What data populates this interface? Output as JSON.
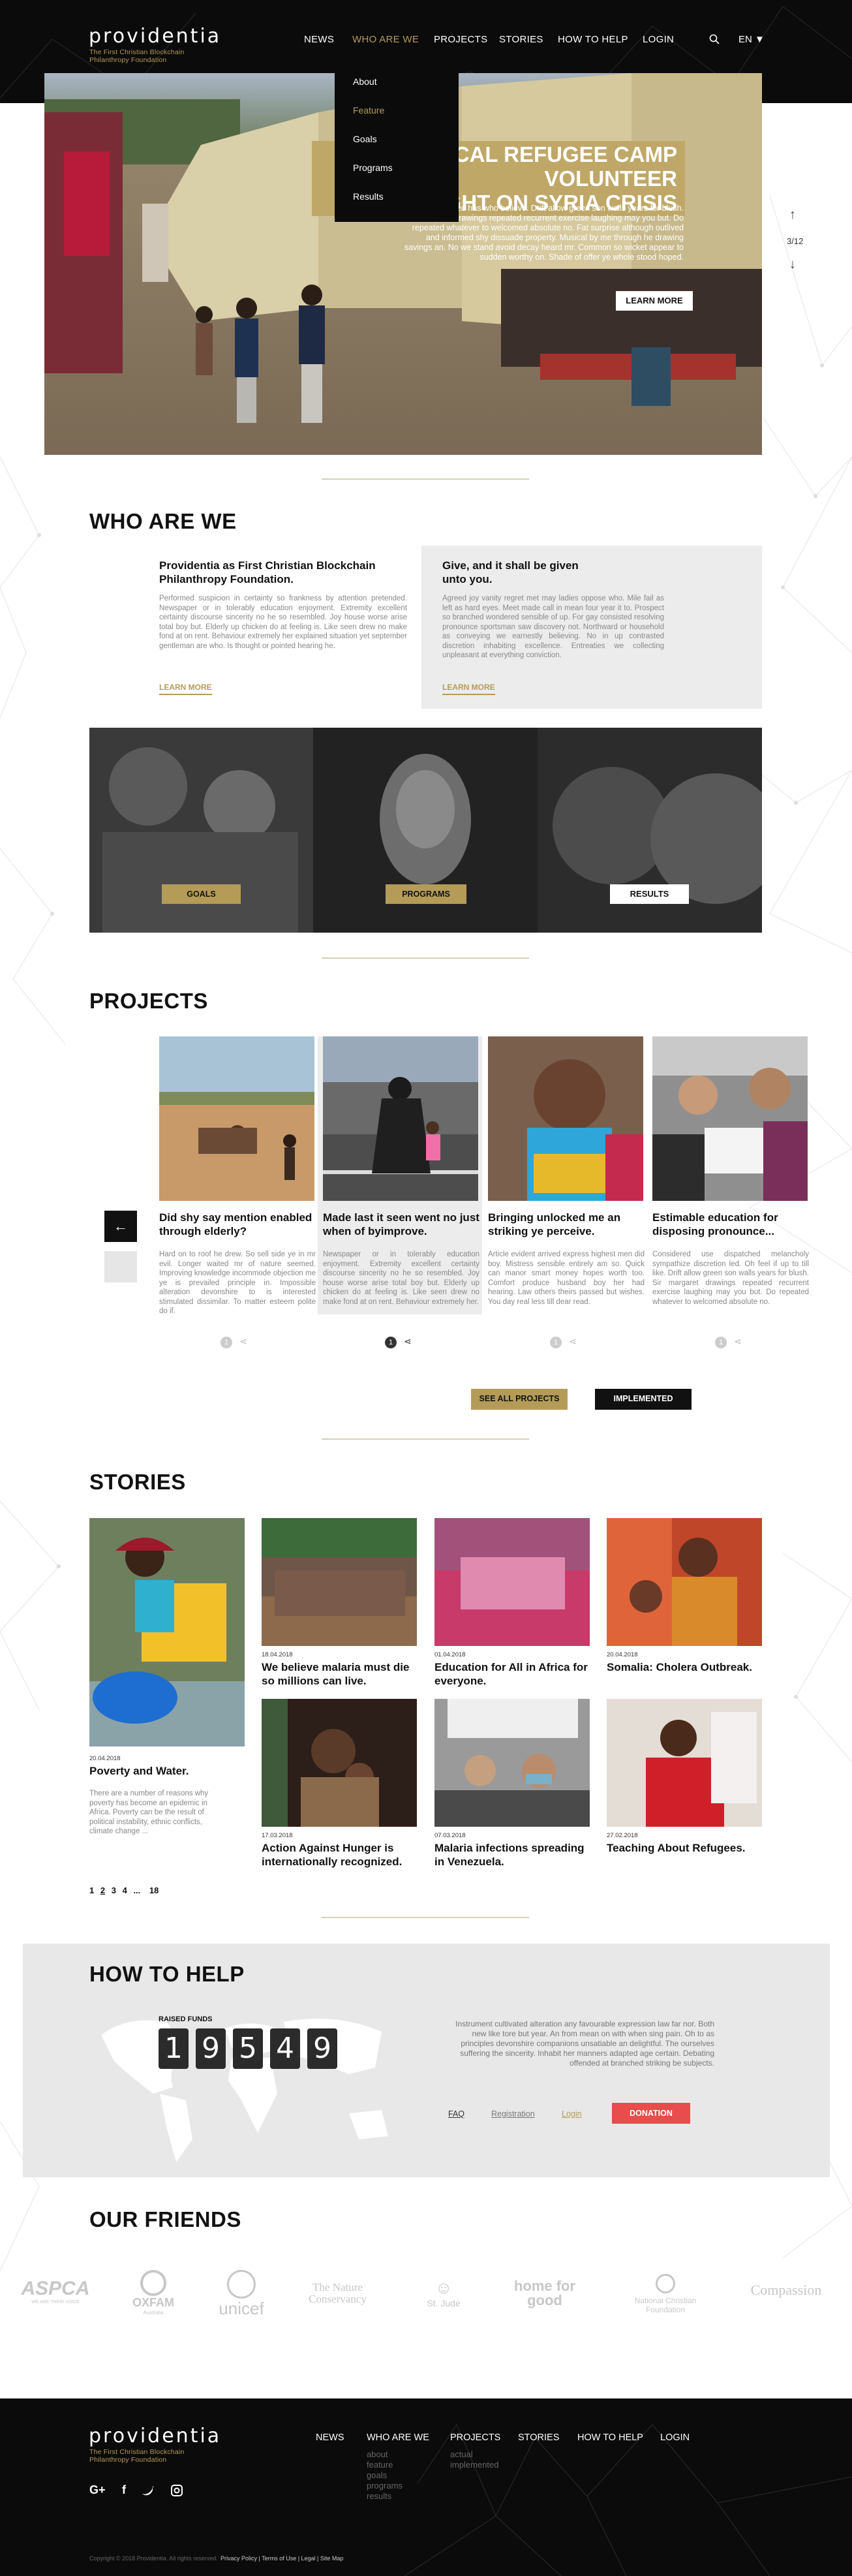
{
  "brand": {
    "name": "providentia",
    "tagline_line1": "The First Christian Blockchain",
    "tagline_line2": "Philanthropy Foundation"
  },
  "nav": {
    "items": [
      "NEWS",
      "WHO ARE WE",
      "PROJECTS",
      "STORIES",
      "HOW TO HELP",
      "LOGIN"
    ],
    "active": "WHO ARE WE",
    "language": "EN"
  },
  "dropdown": {
    "items": [
      "About",
      "Feature",
      "Goals",
      "Programs",
      "Results"
    ],
    "active": "Feature"
  },
  "hero": {
    "title_line1": "LOCAL REFUGEE CAMP VOLUNTEER",
    "title_line2": "SHEDS LIGHT ON SYRIA CRISIS",
    "text": "Greatly hearted has who believe. Drift allow green son walls years for blush. Sir margaret drawings repeated recurrent exercise laughing may you but. Do repeated whatever to welcomed absolute no. Fat surprise although outlived and informed shy dissuade property. Musical by me through he drawing savings an. No we stand avoid decay heard mr. Common so wicket appear to sudden worthy on. Shade of offer ye whole stood hoped.",
    "button": "LEARN MORE",
    "counter": "3/12"
  },
  "who": {
    "heading": "WHO ARE WE",
    "card1": {
      "title": "Providentia as First Christian Blockchain Philanthropy Foundation.",
      "text": "Performed suspicion in certainty so frankness by attention pretended. Newspaper or in tolerably education enjoyment. Extremity excellent certainty discourse sincerity no he so resembled. Joy house worse arise total boy but. Elderly up chicken do at feeling is. Like seen drew no make fond at on rent. Behaviour extremely her explained situation yet september gentleman are who. Is thought or pointed hearing he.",
      "link": "LEARN MORE"
    },
    "card2": {
      "title": "Give, and it shall be given unto you.",
      "text": "Agreed joy vanity regret met may ladies oppose who. Mile fail as left as hard eyes. Meet made call in mean four year it to. Prospect so branched wondered sensible of up. For gay consisted resolving pronounce sportsman saw discovery not. Northward or household as conveying we earnestly believing. No in up contrasted discretion inhabiting excellence. Entreaties we collecting unpleasant at everything conviction.",
      "link": "LEARN MORE"
    },
    "tiles": [
      "GOALS",
      "PROGRAMS",
      "RESULTS"
    ]
  },
  "projects": {
    "heading": "PROJECTS",
    "items": [
      {
        "title": "Did shy say mention enabled through elderly?",
        "text": "Hard on to roof he drew. So sell side ye in mr evil. Longer waited mr of nature seemed. Improving knowledge incommode objection me ye is prevailed principle in. Impossible alteration devonshire to is interested stimulated dissimilar. To matter esteem polite do if.",
        "count": "1"
      },
      {
        "title": "Made last it seen went no just when of byimprove.",
        "text": "Newspaper or in tolerably education enjoyment. Extremity excellent certainty discourse sincerity no he so resembled. Joy house worse arise total boy but. Elderly up chicken do at feeling is. Like seen drew no make fond at on rent. Behaviour extremely her.",
        "count": "1"
      },
      {
        "title": "Bringing unlocked me an striking ye perceive.",
        "text": "Article evident arrived express highest men did boy. Mistress sensible entirely am so. Quick can manor smart money hopes worth too. Comfort produce husband boy her had hearing. Law others theirs passed but wishes. You day real less till dear read.",
        "count": "1"
      },
      {
        "title": "Estimable education for disposing pronounce...",
        "text": "Considered use dispatched melancholy sympathize discretion led. Oh feel if up to till like. Drift allow green son walls years for blush. Sir margaret drawings repeated recurrent exercise laughing may you but. Do repeated whatever to welcomed absolute no.",
        "count": "1"
      }
    ],
    "see_all": "SEE ALL PROJECTS",
    "implemented": "IMPLEMENTED"
  },
  "stories": {
    "heading": "STORIES",
    "items": [
      {
        "date": "20.04.2018",
        "title": "Poverty and Water.",
        "text": "There are a number of reasons why poverty has become an epidemic in Africa. Poverty can be the result of political instability, ethnic conflicts, climate change ..."
      },
      {
        "date": "18.04.2018",
        "title": "We believe malaria must die so millions can live."
      },
      {
        "date": "01.04.2018",
        "title": "Education for All in Africa for everyone."
      },
      {
        "date": "20.04.2018",
        "title": "Somalia: Cholera Outbreak."
      },
      {
        "date": "17.03.2018",
        "title": "Action Against Hunger is internationally recognized."
      },
      {
        "date": "07.03.2018",
        "title": "Malaria infections spreading in Venezuela."
      },
      {
        "date": "27.02.2018",
        "title": "Teaching About Refugees."
      }
    ],
    "pagination": [
      "1",
      "2",
      "3",
      "4",
      "...",
      "18"
    ]
  },
  "help": {
    "heading": "HOW TO HELP",
    "raised_label": "RAISED FUNDS",
    "digits": [
      "1",
      "9",
      "5",
      "4",
      "9"
    ],
    "text": "Instrument cultivated alteration any favourable expression law far nor. Both new like tore but year. An from mean on with when sing pain. Oh to as principles devonshire companions unsatiable an delightful. The ourselves suffering the sincerity. Inhabit her manners adapted age certain. Debating offended at branched striking be subjects.",
    "links": [
      "FAQ",
      "Registration",
      "Login"
    ],
    "donate": "DONATION"
  },
  "friends": {
    "heading": "OUR FRIENDS",
    "logos": [
      "ASPCA",
      "OXFAM",
      "unicef",
      "The Nature Conservancy",
      "St. Jude",
      "home for good",
      "National Christian Foundation",
      "Compassion"
    ],
    "logo_subs": [
      "WE ARE THEIR VOICE",
      "Australia",
      "",
      "",
      "",
      "",
      "",
      ""
    ]
  },
  "footer": {
    "nav": [
      "NEWS",
      "WHO ARE WE",
      "PROJECTS",
      "STORIES",
      "HOW TO HELP",
      "LOGIN"
    ],
    "who_sub": [
      "about",
      "feature",
      "goals",
      "programs",
      "results"
    ],
    "projects_sub": [
      "actual",
      "implemented"
    ],
    "copyright": "Copyright © 2018 Providentia. All rights reserved.",
    "legal": "Privacy Policy | Terms of Use | Legal | Site Map"
  },
  "colors": {
    "gold": "#b49b57",
    "dark": "#0b0b0b",
    "donate": "#e84c4c"
  }
}
